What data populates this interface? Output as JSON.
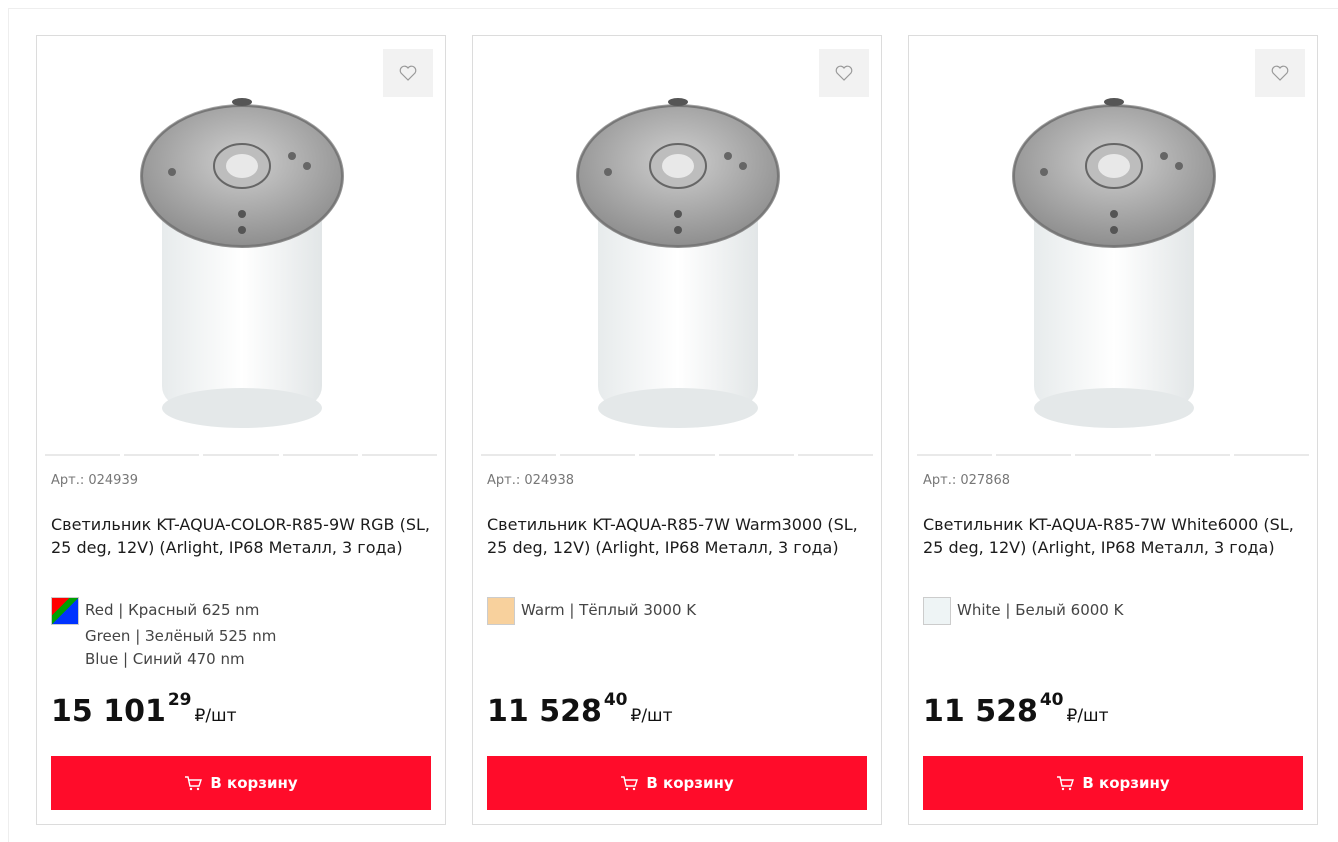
{
  "products": [
    {
      "article": "Арт.: 024939",
      "title": "Светильник KT-AQUA-COLOR-R85-9W RGB (SL, 25 deg, 12V) (Arlight, IP68 Металл, 3 года)",
      "specs": [
        "Red | Красный 625 nm",
        "Green | Зелёный 525 nm",
        "Blue | Синий 470 nm"
      ],
      "swatch": "rgb",
      "price_int": "15 101",
      "price_frac": "29",
      "price_unit": "₽/шт",
      "cart_label": "В корзину"
    },
    {
      "article": "Арт.: 024938",
      "title": "Светильник KT-AQUA-R85-7W Warm3000 (SL, 25 deg, 12V) (Arlight, IP68 Металл, 3 года)",
      "specs": [
        "Warm | Тёплый 3000 K"
      ],
      "swatch": "#f8d19d",
      "price_int": "11 528",
      "price_frac": "40",
      "price_unit": "₽/шт",
      "cart_label": "В корзину"
    },
    {
      "article": "Арт.: 027868",
      "title": "Светильник KT-AQUA-R85-7W White6000 (SL, 25 deg, 12V) (Arlight, IP68 Металл, 3 года)",
      "specs": [
        "White | Белый 6000 K"
      ],
      "swatch": "#eef4f5",
      "price_int": "11 528",
      "price_frac": "40",
      "price_unit": "₽/шт",
      "cart_label": "В корзину"
    }
  ],
  "colors": {
    "accent": "#ff0c2a",
    "border": "#dcdcdc",
    "fav_bg": "#f2f2f2"
  },
  "icons": {
    "favorite": "heart-icon",
    "cart": "cart-icon"
  }
}
